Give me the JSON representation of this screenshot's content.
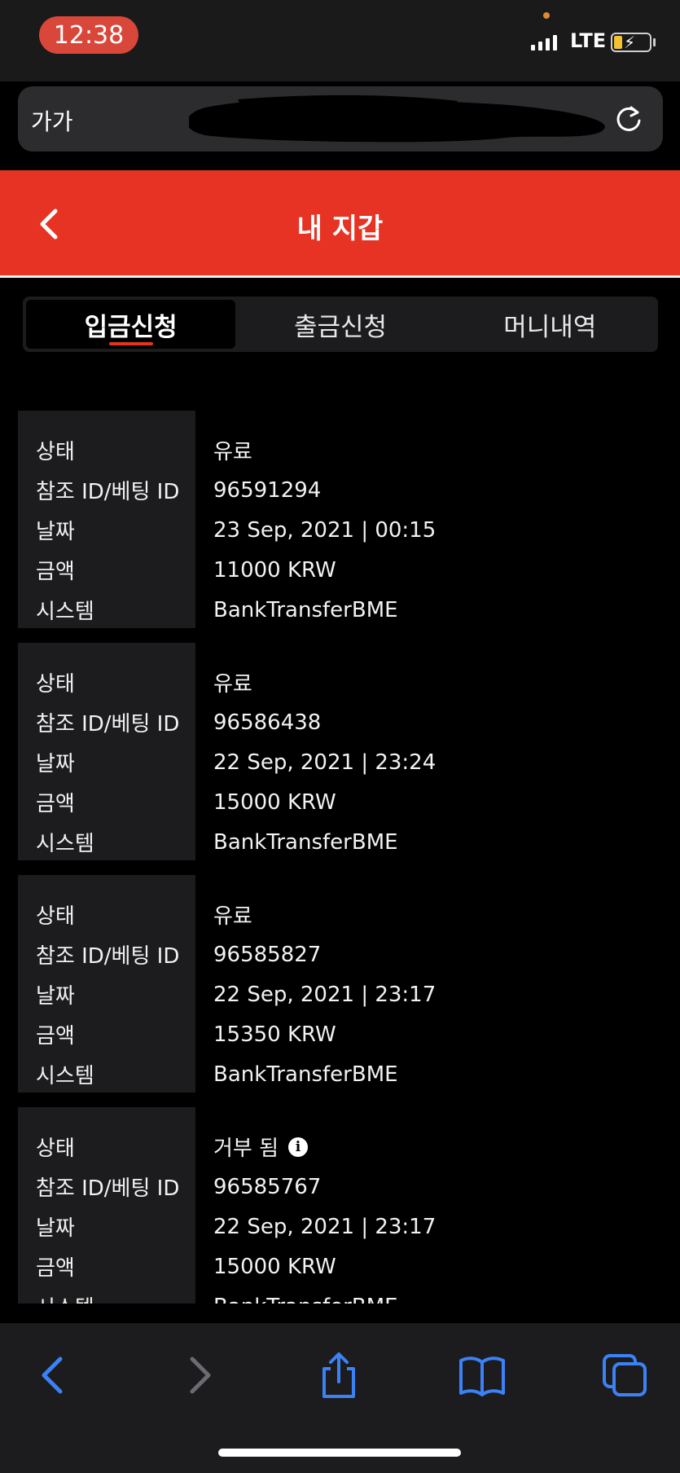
{
  "status_bar": {
    "time": "12:38",
    "network": "LTE"
  },
  "url_bar": {
    "text_size_label": "가가"
  },
  "header": {
    "title": "내 지갑"
  },
  "tabs": [
    {
      "label": "입금신청",
      "active": true
    },
    {
      "label": "출금신청",
      "active": false
    },
    {
      "label": "머니내역",
      "active": false
    }
  ],
  "field_labels": {
    "status": "상태",
    "ref_id": "참조 ID/베팅 ID",
    "date": "날짜",
    "amount": "금액",
    "system": "시스템"
  },
  "transactions": [
    {
      "status": "유료",
      "ref_id": "96591294",
      "date": "23 Sep, 2021 | 00:15",
      "amount": "11000 KRW",
      "system": "BankTransferBME"
    },
    {
      "status": "유료",
      "ref_id": "96586438",
      "date": "22 Sep, 2021 | 23:24",
      "amount": "15000 KRW",
      "system": "BankTransferBME"
    },
    {
      "status": "유료",
      "ref_id": "96585827",
      "date": "22 Sep, 2021 | 23:17",
      "amount": "15350 KRW",
      "system": "BankTransferBME"
    },
    {
      "status": "거부 됨",
      "ref_id": "96585767",
      "date": "22 Sep, 2021 | 23:17",
      "amount": "15000 KRW",
      "system": "BankTransferBME"
    }
  ],
  "colors": {
    "accent": "#e63323",
    "ios_blue": "#3b82f6"
  }
}
